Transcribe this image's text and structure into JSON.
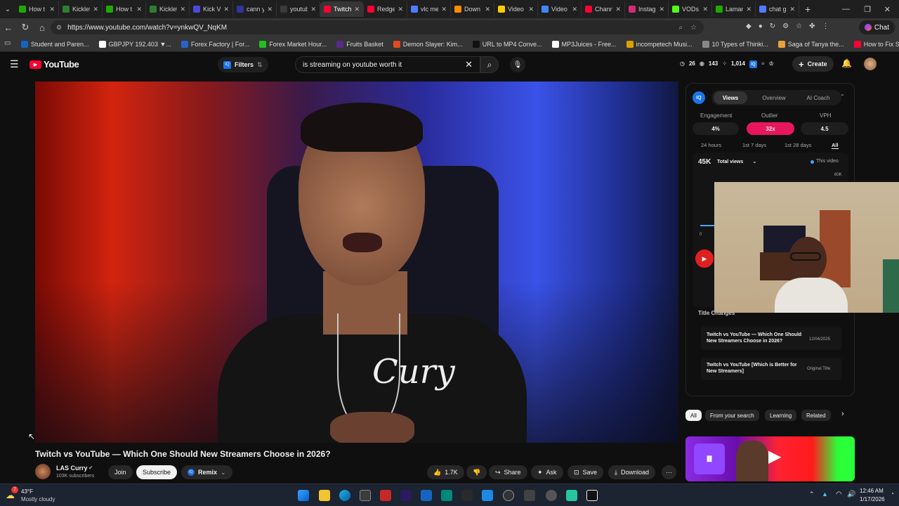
{
  "browser": {
    "tabs": [
      {
        "title": "How t",
        "color": "#1faa00"
      },
      {
        "title": "Kicklet",
        "color": "#2e7d32"
      },
      {
        "title": "How t",
        "color": "#1faa00"
      },
      {
        "title": "Kicklet",
        "color": "#2e7d32"
      },
      {
        "title": "Kick V",
        "color": "#4a4ad8"
      },
      {
        "title": "cann y",
        "color": "#333399"
      },
      {
        "title": "youtub",
        "color": "#3a3a3a"
      },
      {
        "title": "Twitch",
        "color": "#ff0033"
      },
      {
        "title": "Redge",
        "color": "#ff0033"
      },
      {
        "title": "vlc me",
        "color": "#4f7cff"
      },
      {
        "title": "Down",
        "color": "#ff8c00"
      },
      {
        "title": "Video",
        "color": "#ffcc00"
      },
      {
        "title": "Video",
        "color": "#4285f4"
      },
      {
        "title": "Chann",
        "color": "#ff0033"
      },
      {
        "title": "Instag",
        "color": "#d62976"
      },
      {
        "title": "VODs",
        "color": "#53fc18"
      },
      {
        "title": "Laman",
        "color": "#1faa00"
      },
      {
        "title": "chat g",
        "color": "#4f7cff"
      }
    ],
    "active_tab_index": 7,
    "url": "https://www.youtube.com/watch?v=ynkwQV_NqKM",
    "chat_label": "Chat",
    "bookmarks": [
      {
        "label": "Student and Paren...",
        "color": "#1565c0"
      },
      {
        "label": "GBPJPY 192.403 ▼...",
        "color": "#ffffff"
      },
      {
        "label": "Forex Factory | For...",
        "color": "#2a62c9"
      },
      {
        "label": "Forex Market Hour...",
        "color": "#20c020"
      },
      {
        "label": "Fruits Basket",
        "color": "#5b2a86"
      },
      {
        "label": "Demon Slayer: Kim...",
        "color": "#e04a1f"
      },
      {
        "label": "URL to MP4 Conve...",
        "color": "#111111"
      },
      {
        "label": "MP3Juices - Free...",
        "color": "#ffffff"
      },
      {
        "label": "incompetech Musi...",
        "color": "#e0a000"
      },
      {
        "label": "10 Types of Thinki...",
        "color": "#888888"
      },
      {
        "label": "Saga of Tanya the...",
        "color": "#e8a33a"
      },
      {
        "label": "How to Fix Screen...",
        "color": "#ff0033"
      }
    ]
  },
  "youtube": {
    "logo_text": "YouTube",
    "filters_label": "Filters",
    "search_value": "is streaming on youtube worth it",
    "header_stats": [
      "26",
      "143",
      "1,014"
    ],
    "create_label": "Create",
    "video_title": "Twitch vs YouTube — Which One Should New Streamers Choose in 2026?",
    "channel_name": "LAS Curry",
    "subscribers": "103K subscribers",
    "join_label": "Join",
    "subscribe_label": "Subscribe",
    "remix_label": "Remix",
    "likes": "1.7K",
    "share_label": "Share",
    "ask_label": "Ask",
    "save_label": "Save",
    "download_label": "Download",
    "shirt_text": "Cury",
    "chips": [
      "All",
      "From your search",
      "Learning",
      "Related"
    ]
  },
  "panel": {
    "tabs": [
      "Views",
      "Overview",
      "AI Coach"
    ],
    "metrics": [
      {
        "label": "Engagement",
        "value": "4%"
      },
      {
        "label": "Outlier",
        "value": "32x"
      },
      {
        "label": "VPH",
        "value": "4.5"
      }
    ],
    "ranges": [
      "24 hours",
      "1st 7 days",
      "1st 28 days",
      "All"
    ],
    "total_views_value": "45K",
    "total_views_label": "Total views",
    "legend_label": "This video",
    "axis_top": "60K",
    "axis_zero": "0",
    "title_changes_heading": "Title Changes",
    "title_changes": [
      {
        "title": "Twitch vs YouTube — Which One Should New Streamers Choose in 2026?",
        "meta": "12/04/2025"
      },
      {
        "title": "Twitch vs YouTube [Which is Better for New Streamers]",
        "meta": "Original Title"
      }
    ]
  },
  "taskbar": {
    "weather_temp": "43°F",
    "weather_desc": "Mostly cloudy",
    "notification_count": "7",
    "time": "12:46 AM",
    "date": "1/17/2026"
  },
  "colors": {
    "accent_red": "#ff0033",
    "outlier_pink": "#e8175d",
    "iq_blue": "#1a73e8"
  }
}
